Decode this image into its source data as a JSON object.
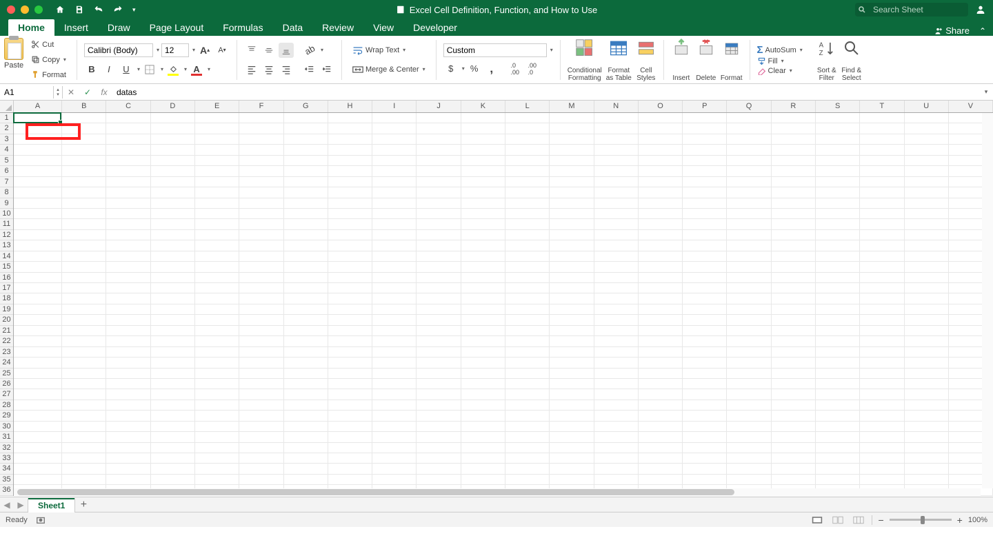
{
  "title": "Excel Cell Definition, Function, and How to Use",
  "search_placeholder": "Search Sheet",
  "tabs": [
    "Home",
    "Insert",
    "Draw",
    "Page Layout",
    "Formulas",
    "Data",
    "Review",
    "View",
    "Developer"
  ],
  "active_tab": "Home",
  "share": "Share",
  "clipboard": {
    "paste": "Paste",
    "cut": "Cut",
    "copy": "Copy",
    "format": "Format"
  },
  "font": {
    "name": "Calibri (Body)",
    "size": "12"
  },
  "alignment": {
    "wrap": "Wrap Text",
    "merge": "Merge & Center"
  },
  "number": {
    "format": "Custom"
  },
  "styles": {
    "cf": "Conditional\nFormatting",
    "fat": "Format\nas Table",
    "cs": "Cell\nStyles"
  },
  "cells_grp": {
    "insert": "Insert",
    "delete": "Delete",
    "format": "Format"
  },
  "editing": {
    "autosum": "AutoSum",
    "fill": "Fill",
    "clear": "Clear",
    "sort": "Sort &\nFilter",
    "find": "Find &\nSelect"
  },
  "namebox": "A1",
  "formula": "datas",
  "columns": [
    "A",
    "B",
    "C",
    "D",
    "E",
    "F",
    "G",
    "H",
    "I",
    "J",
    "K",
    "L",
    "M",
    "N",
    "O",
    "P",
    "Q",
    "R",
    "S",
    "T",
    "U",
    "V"
  ],
  "rows": 36,
  "sheet": "Sheet1",
  "status": "Ready",
  "zoom": "100%"
}
